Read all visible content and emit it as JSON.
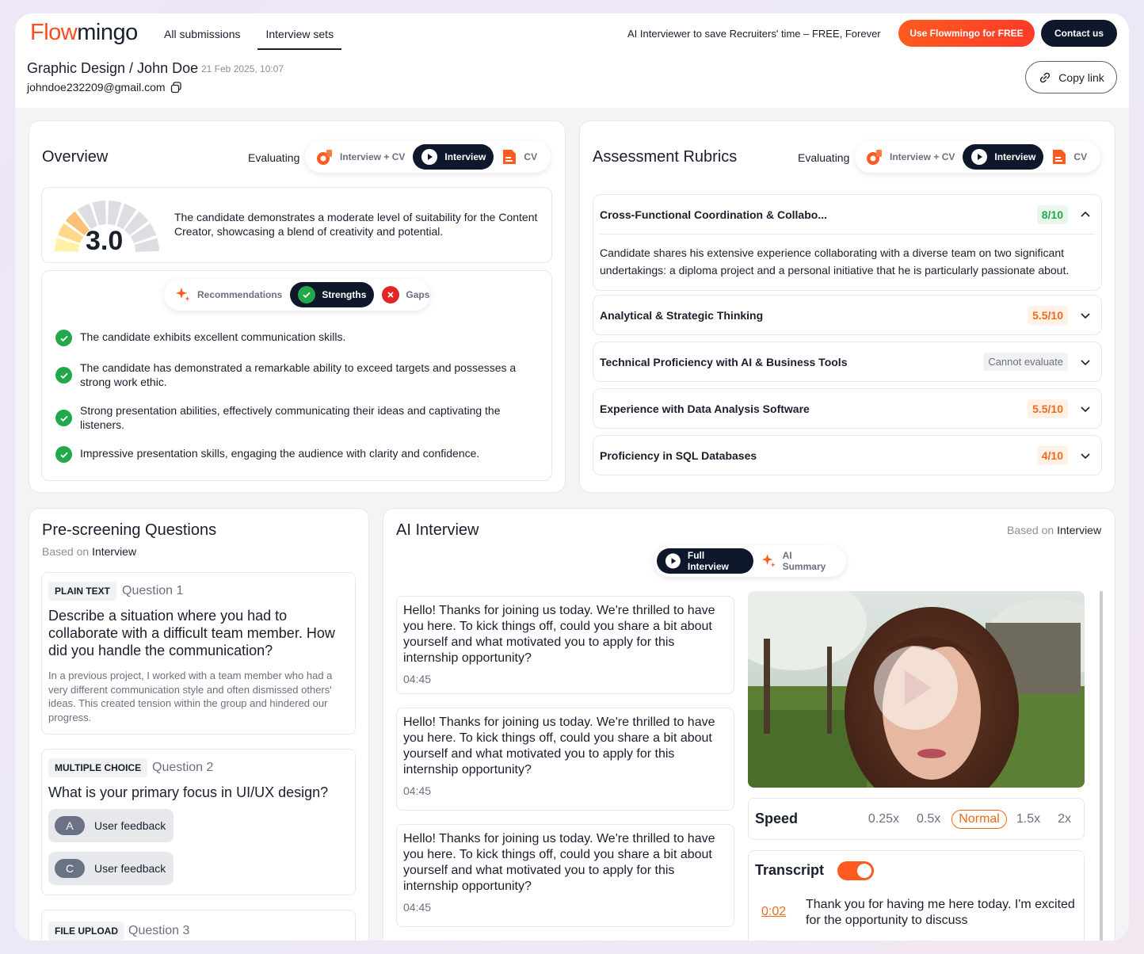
{
  "header": {
    "logo_part1": "Flow",
    "logo_part2": "mingo",
    "nav": [
      "All submissions",
      "Interview sets"
    ],
    "tagline": "AI Interviewer to save Recruiters' time – FREE, Forever",
    "cta_primary": "Use Flowmingo for FREE",
    "cta_secondary": "Contact us",
    "breadcrumb": "Graphic Design / John Doe",
    "date": "21 Feb 2025, 10:07",
    "email": "johndoe232209@gmail.com",
    "copy_link": "Copy link"
  },
  "overview": {
    "title": "Overview",
    "evaluating": "Evaluating",
    "tabs": [
      "Interview + CV",
      "Interview",
      "CV"
    ],
    "score": "3.0",
    "score_fraction": 0.3,
    "summary": "The candidate demonstrates a moderate level of suitability for the Content Creator, showcasing a blend of creativity and potential.",
    "subtabs": [
      "Recommendations",
      "Strengths",
      "Gaps"
    ],
    "strengths": [
      "The candidate exhibits excellent communication skills.",
      "The candidate has demonstrated a remarkable ability to exceed targets and possesses a strong work ethic.",
      "Strong presentation abilities, effectively communicating their ideas and captivating the listeners.",
      "Impressive presentation skills, engaging the audience with clarity and confidence."
    ]
  },
  "rubrics": {
    "title": "Assessment Rubrics",
    "evaluating": "Evaluating",
    "tabs": [
      "Interview + CV",
      "Interview",
      "CV"
    ],
    "items": [
      {
        "name": "Cross-Functional Coordination & Collabo...",
        "score": "8/10",
        "detail": "Candidate shares his extensive experience collaborating with a diverse team on two significant undertakings: a diploma project and a personal initiative that he is particularly passionate about."
      },
      {
        "name": "Analytical & Strategic Thinking",
        "score": "5.5/10"
      },
      {
        "name": "Technical Proficiency with AI & Business Tools",
        "score": "Cannot evaluate"
      },
      {
        "name": "Experience with Data Analysis Software",
        "score": "5.5/10"
      },
      {
        "name": "Proficiency in SQL Databases",
        "score": "4/10"
      }
    ]
  },
  "prescreen": {
    "title": "Pre-screening Questions",
    "based_on_prefix": "Based on",
    "based_on": "Interview",
    "q1": {
      "tag": "PLAIN TEXT",
      "num": "Question 1",
      "text": "Describe a situation where you had to collaborate with a difficult team member. How did you handle the communication?",
      "answer": "In a previous project, I worked with a team member who had a very different communication style and often dismissed others' ideas. This created tension within the group and hindered our progress."
    },
    "q2": {
      "tag": "MULTIPLE CHOICE",
      "num": "Question 2",
      "text": "What is your primary focus in UI/UX design?",
      "options": [
        {
          "letter": "A",
          "label": "User feedback"
        },
        {
          "letter": "C",
          "label": "User feedback"
        }
      ]
    },
    "q3": {
      "tag": "FILE UPLOAD",
      "num": "Question 3"
    }
  },
  "ai_interview": {
    "title": "AI Interview",
    "based_on_prefix": "Based on",
    "based_on": "Interview",
    "tabs": [
      "Full Interview",
      "AI Summary"
    ],
    "messages": [
      {
        "text": "Hello! Thanks for joining us today. We're thrilled to have you here. To kick things off, could you share a bit about yourself and what motivated you to apply for this internship opportunity?",
        "time": "04:45"
      },
      {
        "text": "Hello! Thanks for joining us today. We're thrilled to have you here. To kick things off, could you share a bit about yourself and what motivated you to apply for this internship opportunity?",
        "time": "04:45"
      },
      {
        "text": "Hello! Thanks for joining us today. We're thrilled to have you here. To kick things off, could you share a bit about yourself and what motivated you to apply for this internship opportunity?",
        "time": "04:45"
      }
    ],
    "speed_label": "Speed",
    "speeds": [
      "0.25x",
      "0.5x",
      "Normal",
      "1.5x",
      "2x"
    ],
    "selected_speed": "Normal",
    "transcript_label": "Transcript",
    "transcript_on": true,
    "transcript_time": "0:02",
    "transcript_text": "Thank you for having me here today. I'm excited for the opportunity to discuss"
  },
  "colors": {
    "accent": "#ff5a1f",
    "dark": "#0f172a",
    "success": "#22a84a",
    "warning": "#f06a1a"
  }
}
